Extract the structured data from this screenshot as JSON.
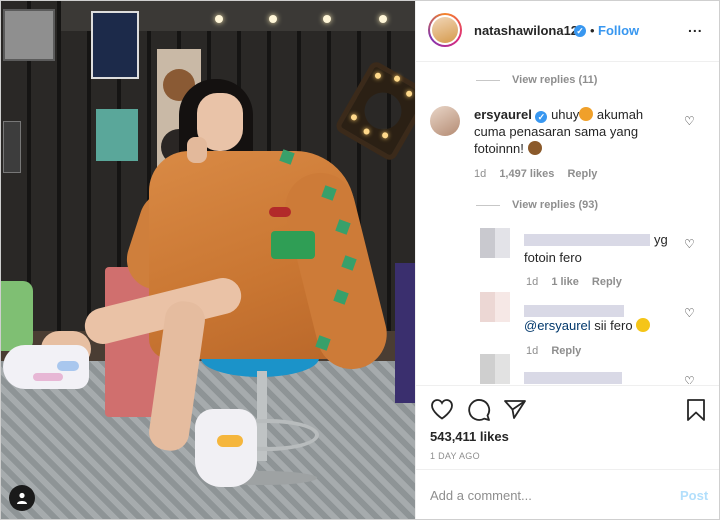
{
  "post": {
    "header": {
      "username": "natashawilona12",
      "separator": "•",
      "follow_label": "Follow",
      "more_label": "..."
    },
    "comments": {
      "replies_1": "View replies (11)",
      "main_comment": {
        "username": "ersyaurel",
        "text_1": "uhuy",
        "text_2": "akumah",
        "text_3": "cuma penasaran sama yang",
        "text_4": "fotoinnn!",
        "age": "1d",
        "likes": "1,497 likes",
        "reply": "Reply"
      },
      "replies_2": "View replies (93)",
      "reply_1": {
        "text_tail": "yg",
        "text_2": "fotoin fero",
        "age": "1d",
        "likes": "1 like",
        "reply": "Reply"
      },
      "reply_2": {
        "mention": "@ersyaurel",
        "text": "sii fero",
        "age": "1d",
        "reply": "Reply"
      }
    },
    "likes": "543,411 likes",
    "time_ago": "1 DAY AGO",
    "add_comment_placeholder": "Add a comment...",
    "post_label": "Post"
  },
  "colors": {
    "accent_blue": "#3897f0",
    "muted_gray": "#8e8e8e",
    "post_disabled": "#b2dffc"
  }
}
